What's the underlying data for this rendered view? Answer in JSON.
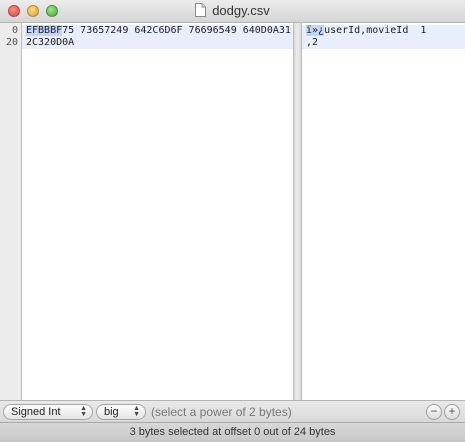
{
  "window": {
    "title": "dodgy.csv"
  },
  "gutter": {
    "lines": [
      "0",
      "20"
    ]
  },
  "hex": {
    "row0": {
      "selected": "EFBBBF",
      "rest": "75 73657249 642C6D6F 76696549 640D0A31"
    },
    "row1": {
      "text": "2C320D0A"
    }
  },
  "ascii": {
    "row0": {
      "selected": "ï»¿",
      "rest": "userId,movieId  1"
    },
    "row1": {
      "text": ",2"
    }
  },
  "controls": {
    "type_select": "Signed Int",
    "endian_select": "big",
    "hint": "(select a power of 2 bytes)",
    "minus_label": "−",
    "plus_label": "+"
  },
  "status": {
    "text": "3 bytes selected at offset 0 out of 24 bytes"
  },
  "colors": {
    "selection": "#c3d4f4",
    "current_line": "#e8eefc"
  }
}
